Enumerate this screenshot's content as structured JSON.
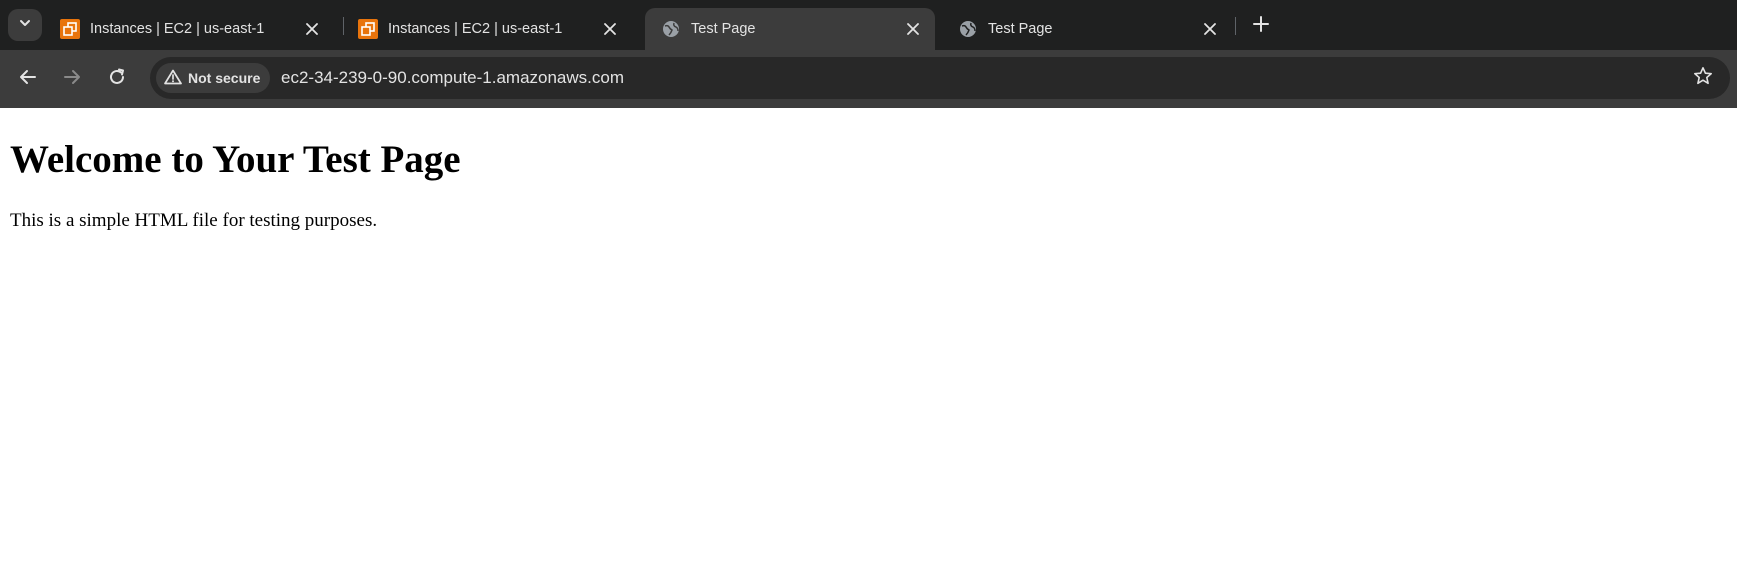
{
  "browser": {
    "tabs": [
      {
        "title": "Instances | EC2 | us-east-1",
        "favicon": "aws-ec2-icon",
        "active": false
      },
      {
        "title": "Instances | EC2 | us-east-1",
        "favicon": "aws-ec2-icon",
        "active": false
      },
      {
        "title": "Test Page",
        "favicon": "globe-icon",
        "active": true
      },
      {
        "title": "Test Page",
        "favicon": "globe-icon",
        "active": false
      }
    ],
    "security_label": "Not secure",
    "url": "ec2-34-239-0-90.compute-1.amazonaws.com",
    "colors": {
      "tabstrip": "#1f2020",
      "toolbar": "#3c3c3c",
      "omnibox": "#282828",
      "ec2_orange": "#e8740c"
    }
  },
  "page": {
    "heading": "Welcome to Your Test Page",
    "paragraph": "This is a simple HTML file for testing purposes."
  }
}
